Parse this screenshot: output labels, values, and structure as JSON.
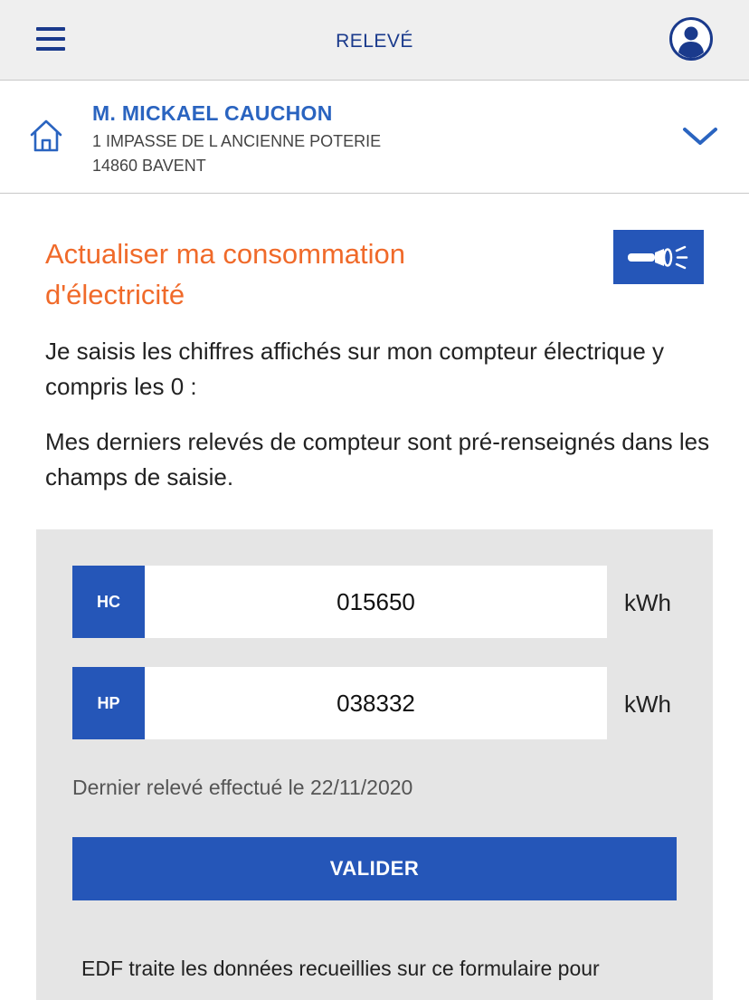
{
  "header": {
    "title": "RELEVÉ",
    "menu_icon": "hamburger-menu-icon",
    "account_icon": "user-account-icon",
    "accent_color": "#1a3a8c"
  },
  "customer": {
    "name": "M. MICKAEL CAUCHON",
    "address_line1": "1 IMPASSE DE L ANCIENNE POTERIE",
    "address_line2": "14860 BAVENT",
    "icon": "home-icon",
    "expand_icon": "chevron-down-icon",
    "name_color": "#2a64c0"
  },
  "main": {
    "heading": "Actualiser ma consommation d'électricité",
    "heading_color": "#f06a2a",
    "torch_icon": "flashlight-icon",
    "intro1": "Je saisis les chiffres affichés sur mon compteur électrique y compris les 0 :",
    "intro2": "Mes derniers relevés de compteur sont pré-renseignés dans les champs de saisie."
  },
  "form": {
    "rows": [
      {
        "tag": "HC",
        "value": "015650",
        "unit": "kWh"
      },
      {
        "tag": "HP",
        "value": "038332",
        "unit": "kWh"
      }
    ],
    "last_reading": "Dernier relevé effectué le 22/11/2020",
    "submit_label": "VALIDER",
    "legal_text": "EDF traite les données recueillies sur ce formulaire pour",
    "button_color": "#2556b8"
  }
}
